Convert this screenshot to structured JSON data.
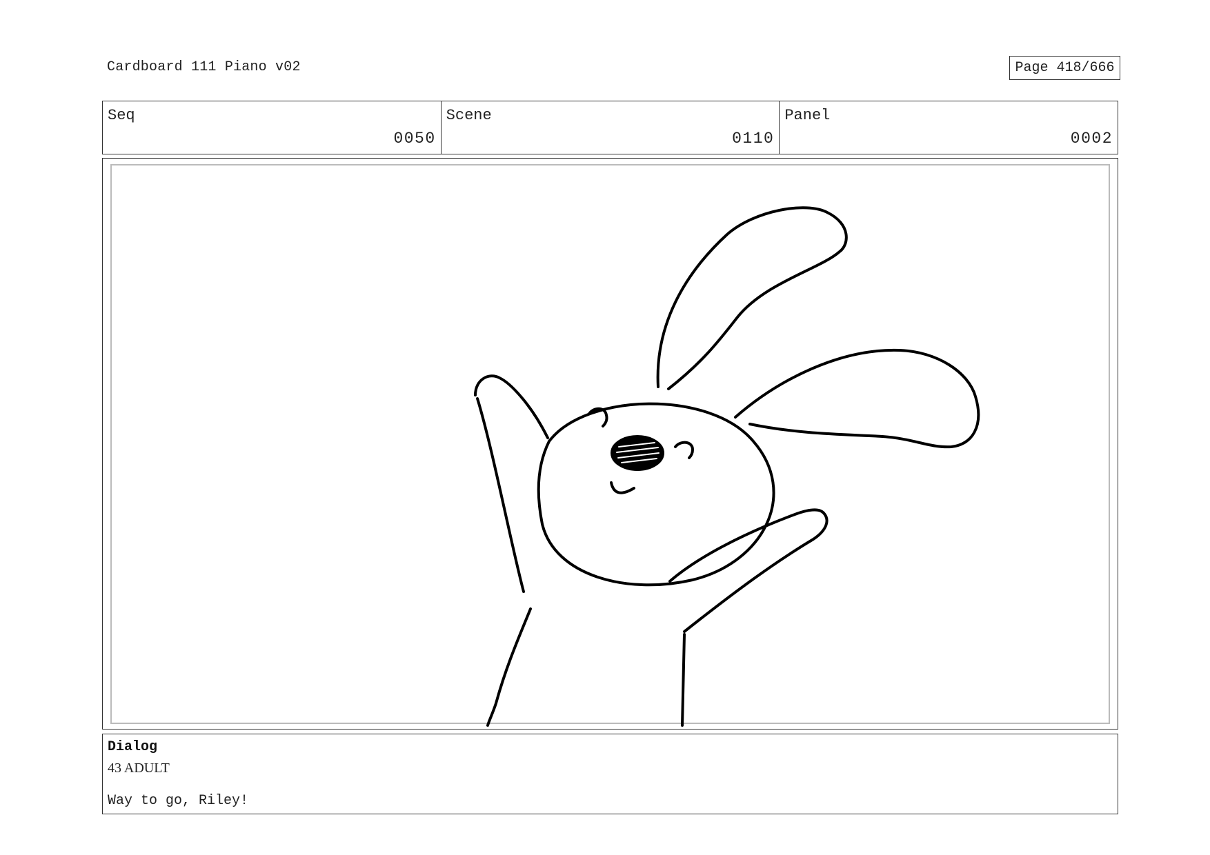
{
  "document": {
    "title": "Cardboard 111 Piano v02",
    "page_indicator": "Page 418/666"
  },
  "meta": {
    "seq_label": "Seq",
    "seq_value": "0050",
    "scene_label": "Scene",
    "scene_value": "0110",
    "panel_label": "Panel",
    "panel_value": "0002"
  },
  "panel": {
    "image_icon": "rabbit-sketch-icon",
    "stroke_color": "#000000",
    "inner_border_color": "#bbbbbb"
  },
  "dialog": {
    "heading": "Dialog",
    "speaker": "43 ADULT",
    "line": "Way to go, Riley!"
  }
}
